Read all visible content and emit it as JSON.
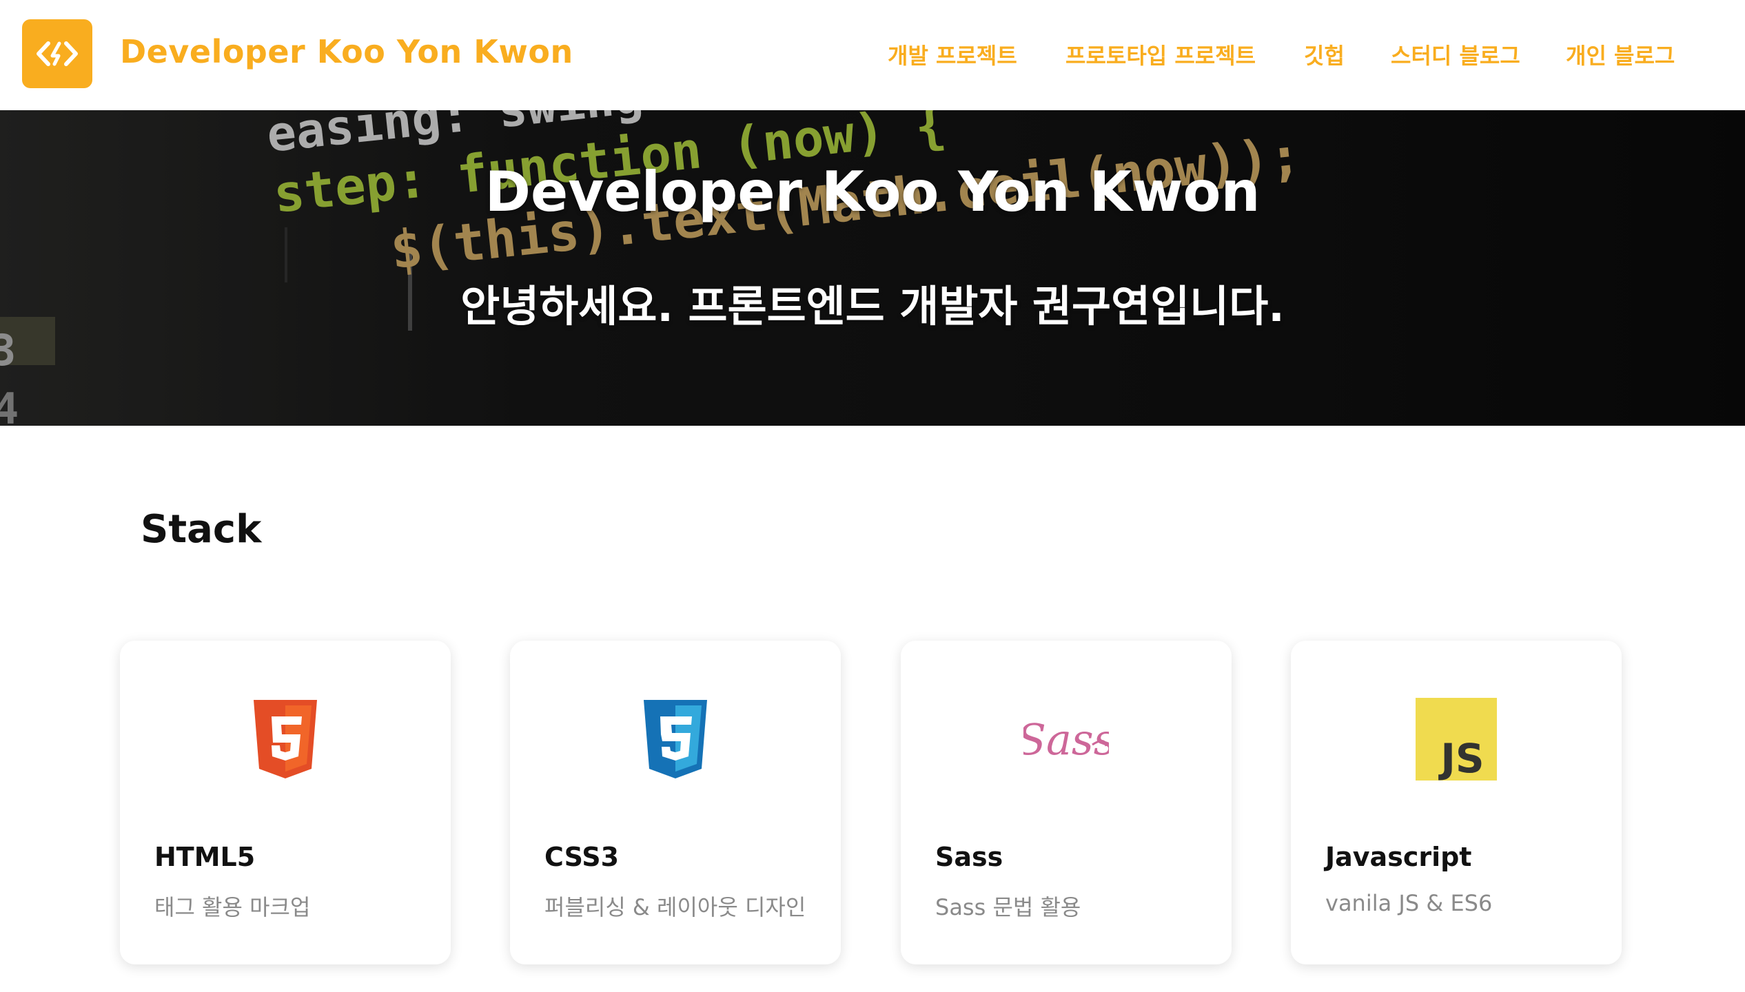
{
  "brand": {
    "name": "Developer Koo Yon Kwon",
    "accent": "#f9ad1f",
    "logo_icon": "code-brackets-icon"
  },
  "nav": {
    "items": [
      {
        "label": "개발 프로젝트"
      },
      {
        "label": "프로토타입 프로젝트"
      },
      {
        "label": "깃헙"
      },
      {
        "label": "스터디 블로그"
      },
      {
        "label": "개인 블로그"
      }
    ]
  },
  "hero": {
    "title": "Developer Koo Yon Kwon",
    "subtitle": "안녕하세요. 프론트엔드 개발자 권구연입니다.",
    "code_lines": [
      "easing: swing",
      "step: function (now) {",
      "$(this).text(Math.ceil(now));",
      "3",
      "4"
    ]
  },
  "stack": {
    "title": "Stack",
    "cards": [
      {
        "icon": "html5-icon",
        "title": "HTML5",
        "desc": "태그 활용 마크업"
      },
      {
        "icon": "css3-icon",
        "title": "CSS3",
        "desc": "퍼블리싱 & 레이아웃 디자인"
      },
      {
        "icon": "sass-icon",
        "title": "Sass",
        "icon_text": "Sass",
        "desc": "Sass 문법 활용"
      },
      {
        "icon": "javascript-icon",
        "title": "Javascript",
        "icon_text": "JS",
        "desc": "vanila JS & ES6"
      }
    ]
  }
}
